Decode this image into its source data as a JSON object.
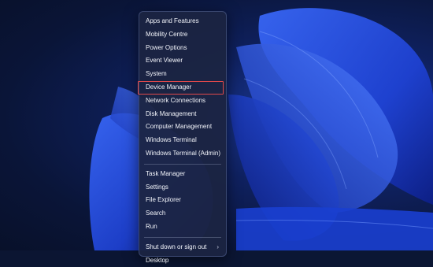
{
  "menu": {
    "groups": [
      {
        "items": [
          {
            "label": "Apps and Features"
          },
          {
            "label": "Mobility Centre"
          },
          {
            "label": "Power Options"
          },
          {
            "label": "Event Viewer"
          },
          {
            "label": "System"
          },
          {
            "label": "Device Manager",
            "highlighted": true
          },
          {
            "label": "Network Connections"
          },
          {
            "label": "Disk Management"
          },
          {
            "label": "Computer Management"
          },
          {
            "label": "Windows Terminal"
          },
          {
            "label": "Windows Terminal (Admin)"
          }
        ]
      },
      {
        "items": [
          {
            "label": "Task Manager"
          },
          {
            "label": "Settings"
          },
          {
            "label": "File Explorer"
          },
          {
            "label": "Search"
          },
          {
            "label": "Run"
          }
        ]
      },
      {
        "items": [
          {
            "label": "Shut down or sign out",
            "submenu": true,
            "chevron": "›"
          },
          {
            "label": "Desktop"
          }
        ]
      }
    ]
  },
  "colors": {
    "highlight_outline": "#e0494b",
    "menu_background": "#1c2442",
    "wallpaper_accent": "#2f5cff"
  }
}
